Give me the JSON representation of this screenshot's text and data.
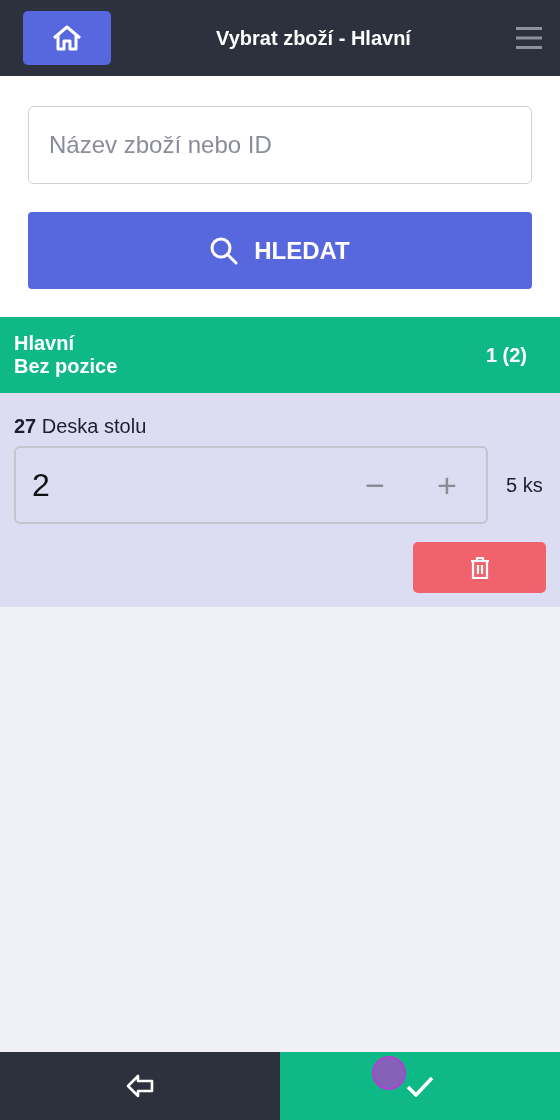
{
  "header": {
    "title": "Vybrat zboží - Hlavní"
  },
  "search": {
    "placeholder": "Název zboží nebo ID",
    "button": "HLEDAT"
  },
  "group": {
    "title": "Hlavní",
    "subtitle": "Bez pozice",
    "count": "1 (2)"
  },
  "items": [
    {
      "name": "**27** Deska stolu",
      "quantity": "2",
      "minus": "−",
      "plus": "+",
      "stock": "5 ks"
    }
  ]
}
